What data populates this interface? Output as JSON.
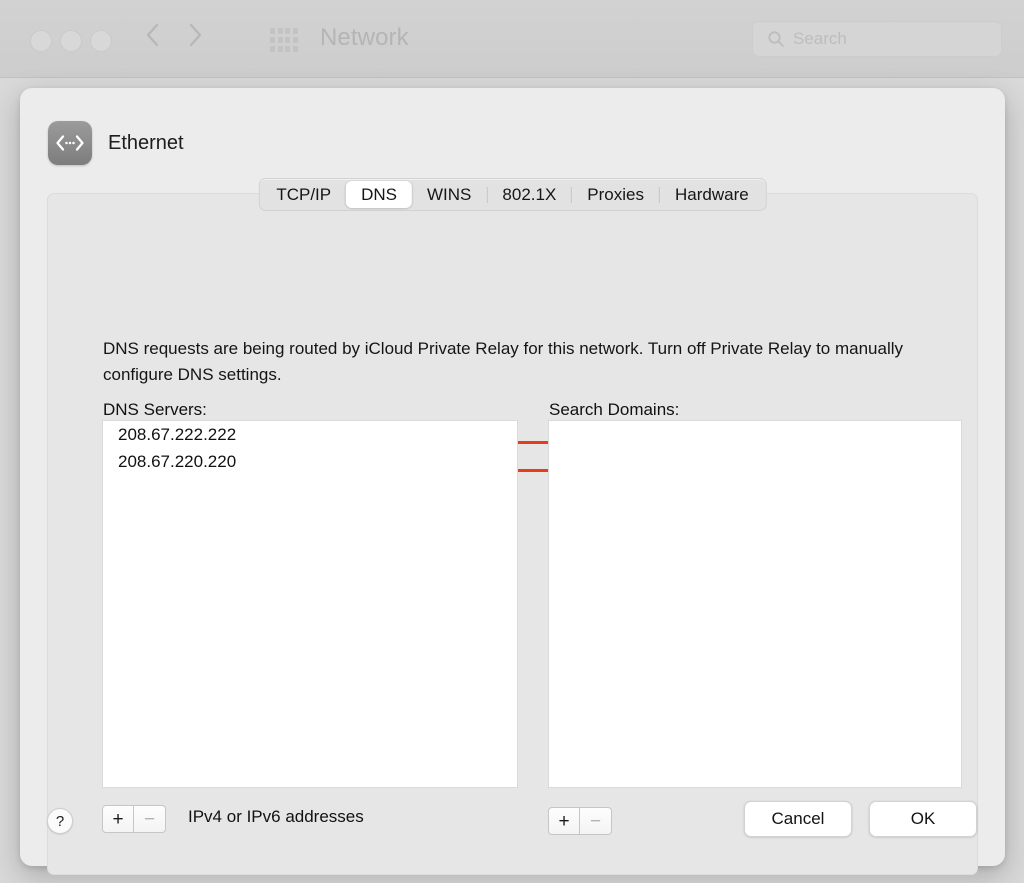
{
  "window": {
    "title": "Network",
    "traffic_lights": [
      "close",
      "minimize",
      "zoom"
    ],
    "search": {
      "placeholder": "Search",
      "value": "",
      "icon": "search-icon"
    },
    "nav": {
      "back_icon": "chevron-left-icon",
      "forward_icon": "chevron-right-icon",
      "grid_icon": "show-all-grid-icon"
    }
  },
  "sheet": {
    "service_name": "Ethernet",
    "service_icon": "ethernet-icon",
    "tabs": [
      {
        "label": "TCP/IP",
        "selected": false,
        "separator_after": false
      },
      {
        "label": "DNS",
        "selected": true,
        "separator_after": false
      },
      {
        "label": "WINS",
        "selected": false,
        "separator_after": true
      },
      {
        "label": "802.1X",
        "selected": false,
        "separator_after": true
      },
      {
        "label": "Proxies",
        "selected": false,
        "separator_after": true
      },
      {
        "label": "Hardware",
        "selected": false,
        "separator_after": false
      }
    ],
    "info": {
      "sentence_highlighted": "DNS requests are being routed by iCloud Private Relay for this network.",
      "sentence_rest": " Turn off Private Relay to manually configure DNS settings.",
      "full_text": "DNS requests are being routed by iCloud Private Relay for this network. Turn off Private Relay to manually configure DNS settings."
    },
    "annotation": {
      "shape": "rectangle",
      "color": "#ea3c1d",
      "target": "DNS requests are being routed by iCloud Private Relay for this network."
    },
    "dns_servers": {
      "label": "DNS Servers:",
      "entries": [
        "208.67.222.222",
        "208.67.220.220"
      ],
      "add_label": "+",
      "remove_label": "−",
      "add_enabled": true,
      "remove_enabled": false,
      "hint": "IPv4 or IPv6 addresses"
    },
    "search_domains": {
      "label": "Search Domains:",
      "entries": [],
      "add_label": "+",
      "remove_label": "−",
      "add_enabled": true,
      "remove_enabled": false
    },
    "footer": {
      "help_label": "?",
      "cancel_label": "Cancel",
      "ok_label": "OK"
    }
  }
}
